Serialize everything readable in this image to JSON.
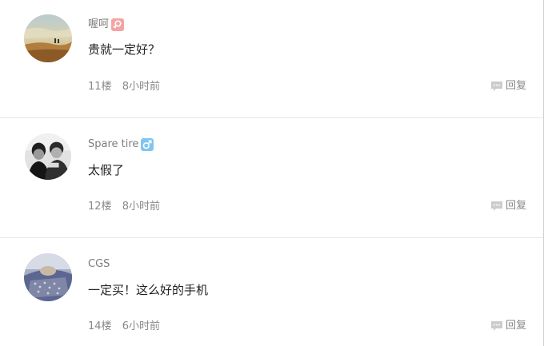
{
  "comments": [
    {
      "username": "喔呵",
      "gender_icon": "female-icon",
      "gender_color": "#f4a4a4",
      "text": "贵就一定好？",
      "floor": "11楼",
      "time": "8小时前",
      "reply_label": "回复"
    },
    {
      "username": "Spare tire",
      "gender_icon": "male-icon",
      "gender_color": "#7ec6ee",
      "text": "太假了",
      "floor": "12楼",
      "time": "8小时前",
      "reply_label": "回复"
    },
    {
      "username": "CGS",
      "text": "一定买！这么好的手机",
      "floor": "14楼",
      "time": "6小时前",
      "reply_label": "回复"
    }
  ]
}
